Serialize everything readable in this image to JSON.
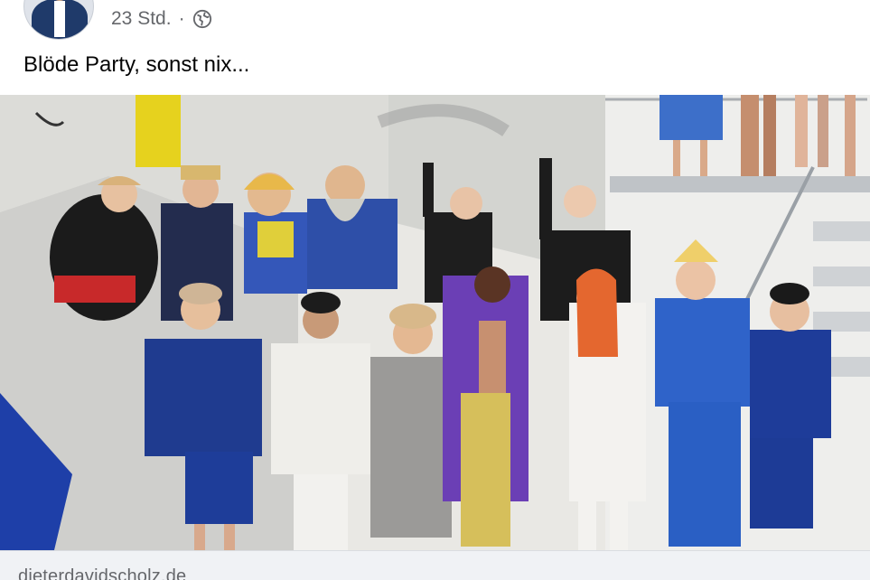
{
  "post": {
    "timestamp": "23 Std.",
    "separator": "·",
    "audience_icon": "globe-icon",
    "text": "Blöde Party, sonst nix..."
  },
  "link_preview": {
    "domain": "dieterdavidscholz.de"
  },
  "colors": {
    "meta_text": "#65676b",
    "link_bar_bg": "#f0f2f5"
  }
}
